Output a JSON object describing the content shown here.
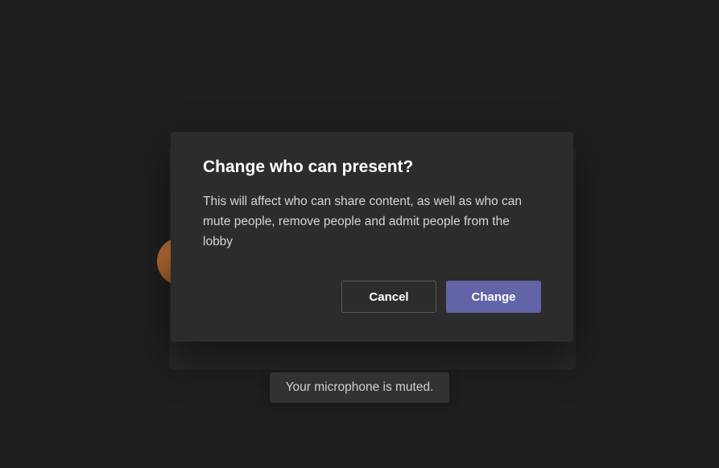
{
  "dialog": {
    "title": "Change who can present?",
    "body": "This will affect who can share content, as well as who can mute people, remove people and admit people from the lobby",
    "cancel_label": "Cancel",
    "confirm_label": "Change"
  },
  "toast": {
    "message": "Your microphone is muted."
  },
  "colors": {
    "accent": "#6264a7",
    "background": "#1f1f1f",
    "dialog_bg": "#2d2c2c"
  }
}
